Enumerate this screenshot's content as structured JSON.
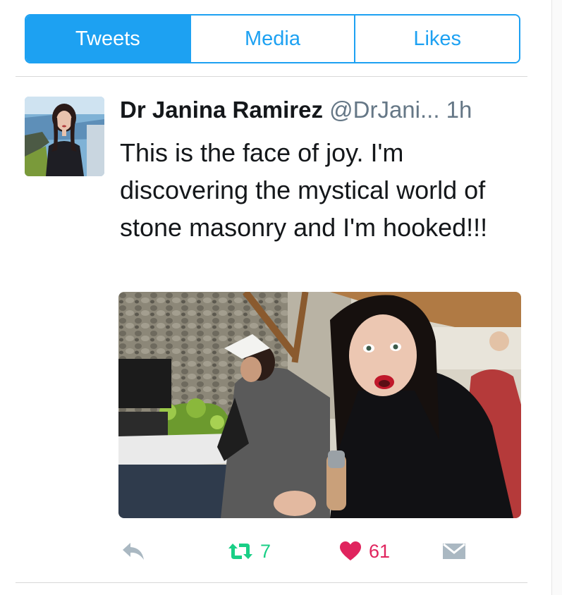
{
  "tabs": [
    {
      "label": "Tweets",
      "active": true
    },
    {
      "label": "Media",
      "active": false
    },
    {
      "label": "Likes",
      "active": false
    }
  ],
  "tweet": {
    "author_name": "Dr Janina Ramirez",
    "handle": "@DrJani...",
    "time": "1h",
    "text": "This is the face of joy. I'm discovering the mystical world of stone masonry and I'm hooked!!!",
    "retweet_count": "7",
    "like_count": "61"
  },
  "icons": {
    "reply": "reply-icon",
    "retweet": "retweet-icon",
    "like": "heart-icon",
    "message": "envelope-icon"
  },
  "colors": {
    "accent": "#1da1f2",
    "retweet": "#19cf86",
    "like": "#e0245e",
    "muted": "#aab8c2"
  }
}
